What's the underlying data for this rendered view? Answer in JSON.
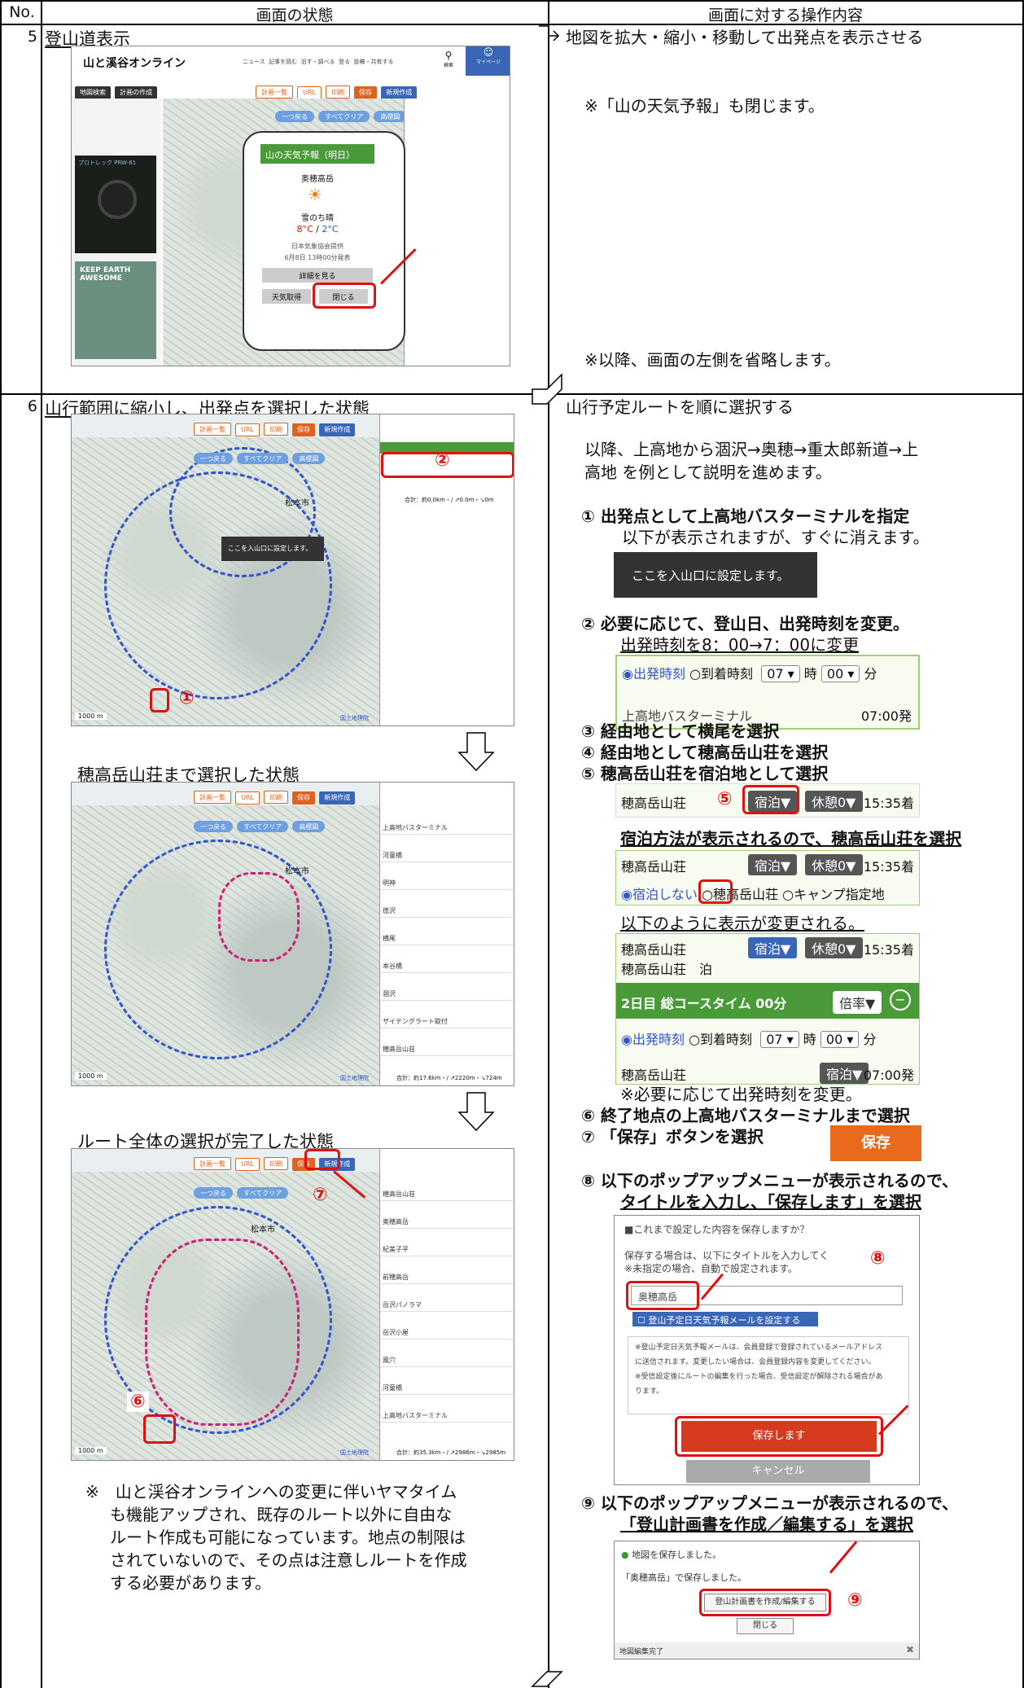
{
  "header": {
    "no": "No.",
    "state": "画面の状態",
    "operation": "画面に対する操作内容"
  },
  "row5": {
    "num": "5",
    "title": "登山道表示",
    "op_title": "地図を拡大・縮小・移動して出発点を表示させる",
    "note1": "※「山の天気予報」も閉じます。",
    "note2": "※以降、画面の左側を省略します。",
    "screenshot": {
      "logo": "山と溪谷オンライン",
      "nav": [
        "ニュース",
        "記事を読む",
        "泊す・調べる",
        "登る",
        "投稿・共有する"
      ],
      "search_label": "検索",
      "mypage_label": "マイページ",
      "map_btns": [
        "一つ戻る",
        "すべてクリア",
        "高標図"
      ],
      "toolbar": [
        "計画一覧",
        "URL",
        "印刷",
        "保存",
        "新規作成"
      ],
      "side_tabs": [
        "地図検索",
        "計画の作成"
      ],
      "ad_label": "プロトレック PRW-61",
      "ad2": "KEEP EARTH AWESOME",
      "weather": {
        "title": "山の天気予報（明日）",
        "place": "奥穂高岳",
        "desc": "雪のち晴",
        "temp_high": "8°C",
        "slash": " / ",
        "temp_low": "2°C",
        "provider": "日本気象協会提供",
        "issued": "6月8日 13時00分発表",
        "detail_btn": "詳細を見る",
        "get_btn": "天気取得",
        "close_btn": "閉じる"
      }
    }
  },
  "row6": {
    "num": "6",
    "title": "山行範囲に縮小し、出発点を選択した状態",
    "title2": "穂高岳山荘まで選択した状態",
    "title3": "ルート全体の選択が完了した状態",
    "map_tooltip": "ここを入山口に設定します。",
    "city": "松本市",
    "scale": "1000 m",
    "attrib": "国土地理院",
    "total1": "合計：約0.0km・/ ↗0.0m・↘0m",
    "total2": "合計：約17.6km・/ ↗2220m・↘724m",
    "total3": "合計：約35.3km・/ ↗2986m・↘2985m",
    "panel_rows2": [
      "上高地バスターミナル",
      "河童橋",
      "明神",
      "徳沢",
      "横尾",
      "本谷橋",
      "涸沢",
      "ザイテングラート取付",
      "穂高岳山荘"
    ],
    "panel_rows3": [
      "穂高岳山荘",
      "奥穂高岳",
      "紀美子平",
      "前穂高岳",
      "岳沢パノラマ",
      "岳沢小屋",
      "風穴",
      "河童橋",
      "上高地バスターミナル"
    ],
    "footnote": [
      "※　山と渓谷オンラインへの変更に伴いヤマタイム",
      "も機能アップされ、既存のルート以外に自由な",
      "ルート作成も可能になっています。地点の制限は",
      "されていないので、その点は注意しルートを作成",
      "する必要があります。"
    ],
    "op_title": "山行予定ルートを順に選択する",
    "intro1": "以降、上高地から涸沢→奥穂→重太郎新道→上",
    "intro2": "高地 を例として説明を進めます。",
    "s1": "①  出発点として上高地バスターミナルを指定",
    "s1b": "以下が表示されますが、すぐに消えます。",
    "s1_box": "ここを入山口に設定します。",
    "s2": "②  必要に応じて、登山日、出発時刻を変更。",
    "s2b": "出発時刻を8：00→7：00に変更",
    "time": {
      "depart": "◉出発時刻",
      "arrive": "○到着時刻",
      "hour": "07",
      "hour_unit": "時",
      "min": "00",
      "min_unit": "分",
      "place": "上高地バスターミナル",
      "dep_time": "07:00発"
    },
    "s3": "③  経由地として横尾を選択",
    "s4": "④  経由地として穂高岳山荘を選択",
    "s5": "⑤  穂高岳山荘を宿泊地として選択",
    "stay": {
      "place": "穂高岳山荘",
      "stay_btn": "宿泊▼",
      "rest_btn": "休憩0▼",
      "arr": "15:35着",
      "num": "⑤"
    },
    "s5b": "宿泊方法が表示されるので、穂高岳山荘を選択",
    "stay_opts": [
      "◉宿泊しない",
      "○穂高岳山荘",
      "○キャンプ指定地"
    ],
    "s5c": "以下のように表示が変更される。",
    "stay2": {
      "place": "穂高岳山荘",
      "sub": "穂高岳山荘　泊",
      "day2": "2日目 総コースタイム 00分",
      "ratio": "倍率▼",
      "minus": "−",
      "dep_time": "07:00発"
    },
    "s5d": "※必要に応じて出発時刻を変更。",
    "s6": "⑥  終了地点の上高地バスターミナルまで選択",
    "s7": "⑦  「保存」ボタンを選択",
    "save_btn": "保存",
    "s8a": "⑧  以下のポップアップメニューが表示されるので、",
    "s8b": "タイトルを入力し、「保存します」を選択",
    "save_dialog": {
      "q": "■これまで設定した内容を保存しますか？",
      "l1": "保存する場合は、以下にタイトルを入力してく",
      "l2": "※未指定の場合、自動で設定されます。",
      "input": "奥穂高岳",
      "mail": "登山予定日天気予報メールを設定する",
      "n1": "※登山予定日天気予報メールは、会員登録で登録されているメールアドレス",
      "n2": "に送信されます。変更したい場合は、会員登録内容を変更してください。",
      "n3": "※受信設定後にルートの編集を行った場合、受信設定が解除される場合があ",
      "n4": "ります。",
      "save": "保存します",
      "cancel": "キャンセル",
      "num": "⑧"
    },
    "s9a": "⑨  以下のポップアップメニューが表示されるので、",
    "s9b": "「登山計画書を作成／編集する」を選択",
    "done_dialog": {
      "l1": "地図を保存しました。",
      "l2": "「奥穂高岳」で保存しました。",
      "btn": "登山計画書を作成/編集する",
      "close": "閉じる",
      "footer": "地図編集完了",
      "x": "✖",
      "num": "⑨"
    },
    "nums": {
      "n1": "①",
      "n2": "②",
      "n6": "⑥",
      "n7": "⑦"
    }
  }
}
